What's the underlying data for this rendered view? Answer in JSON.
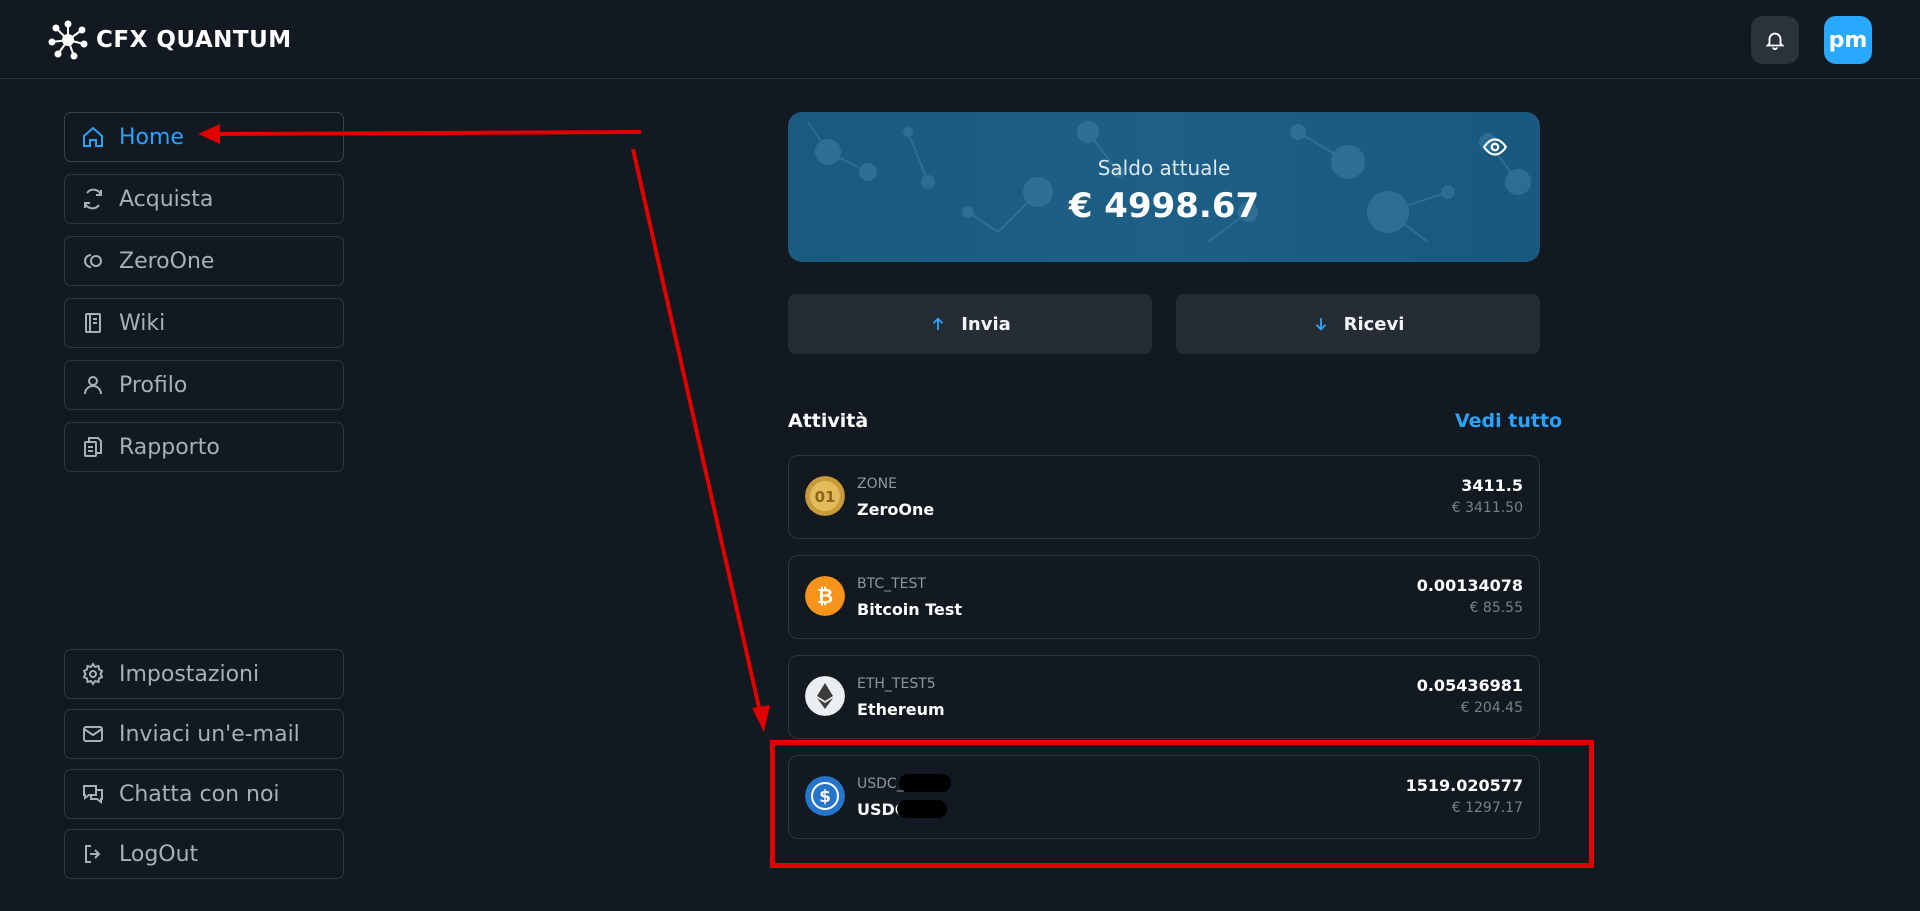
{
  "app": {
    "name": "CFX QUANTUM",
    "avatar_initials": "pm"
  },
  "sidebar": {
    "items": [
      {
        "label": "Home",
        "icon": "home-icon",
        "active": true
      },
      {
        "label": "Acquista",
        "icon": "refresh-icon"
      },
      {
        "label": "ZeroOne",
        "icon": "zeroone-icon"
      },
      {
        "label": "Wiki",
        "icon": "book-icon"
      },
      {
        "label": "Profilo",
        "icon": "user-icon"
      },
      {
        "label": "Rapporto",
        "icon": "report-icon"
      }
    ],
    "bottom_items": [
      {
        "label": "Impostazioni",
        "icon": "gear-icon"
      },
      {
        "label": "Inviaci un'e-mail",
        "icon": "mail-icon"
      },
      {
        "label": "Chatta con noi",
        "icon": "chat-icon"
      },
      {
        "label": "LogOut",
        "icon": "logout-icon"
      }
    ]
  },
  "balance": {
    "label": "Saldo attuale",
    "value": "€ 4998.67"
  },
  "actions": {
    "send": "Invia",
    "receive": "Ricevi"
  },
  "activity": {
    "title": "Attività",
    "see_all": "Vedi tutto",
    "items": [
      {
        "symbol": "ZONE",
        "name": "ZeroOne",
        "amount": "3411.5",
        "value": "€ 3411.50",
        "icon": "zeroone-coin-icon"
      },
      {
        "symbol": "BTC_TEST",
        "name": "Bitcoin Test",
        "amount": "0.00134078",
        "value": "€ 85.55",
        "icon": "bitcoin-icon"
      },
      {
        "symbol": "ETH_TEST5",
        "name": "Ethereum",
        "amount": "0.05436981",
        "value": "€ 204.45",
        "icon": "ethereum-icon"
      },
      {
        "symbol": "USDC_",
        "name": "USDC",
        "amount": "1519.020577",
        "value": "€ 1297.17",
        "icon": "usdc-icon"
      }
    ]
  },
  "colors": {
    "accent": "#2aa3ff",
    "background": "#121920",
    "annotation": "#e00000"
  }
}
